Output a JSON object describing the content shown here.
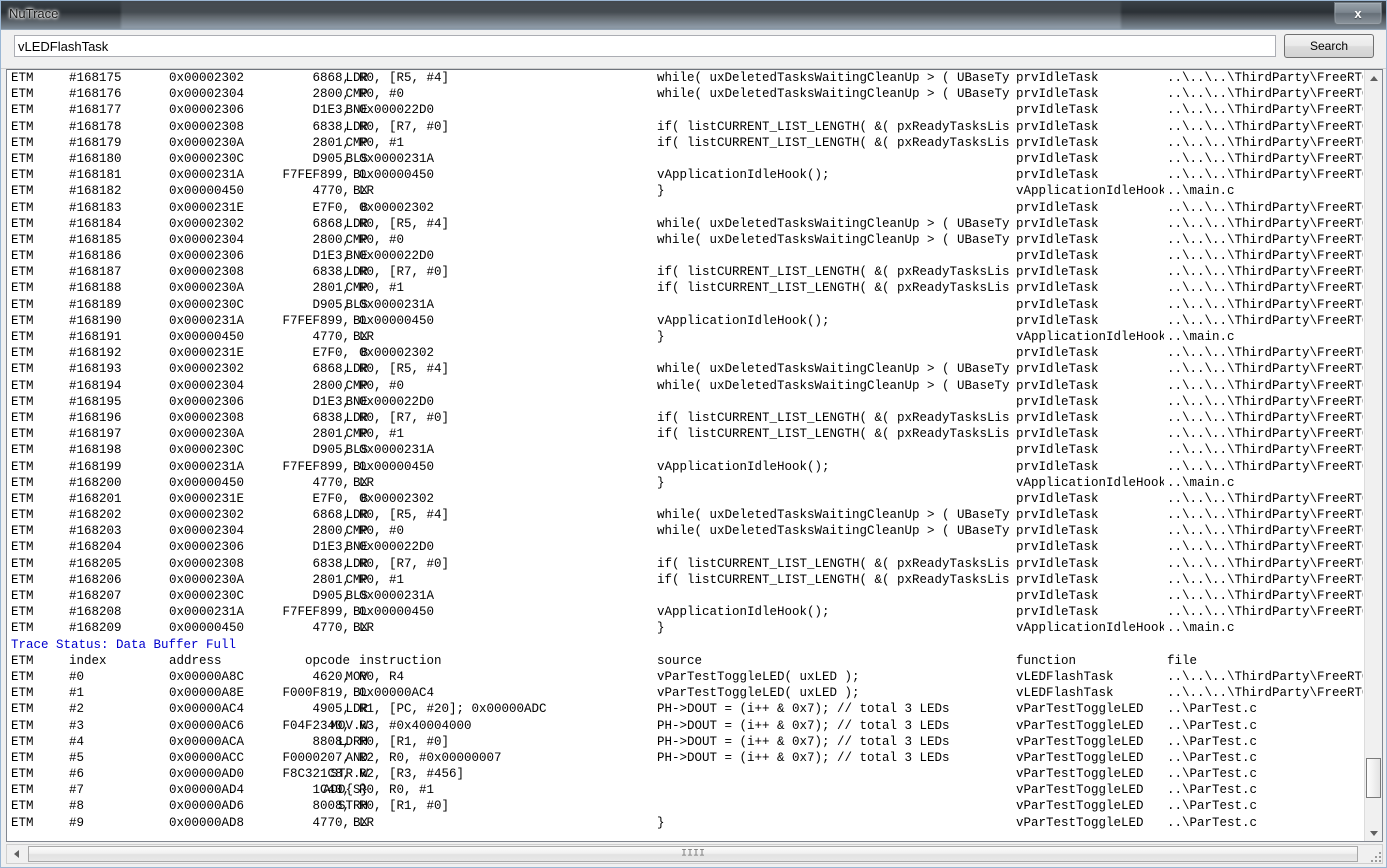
{
  "window": {
    "title": "NuTrace",
    "close_label": "x"
  },
  "search": {
    "value": "vLEDFlashTask",
    "placeholder": "",
    "button_label": "Search"
  },
  "columns": {
    "etm": "ETM",
    "index": "index",
    "address": "address",
    "opcode": "opcode",
    "instruction": "instruction",
    "source": "source",
    "function": "function",
    "file": "file"
  },
  "status": {
    "trace_status": "Trace Status: Data Buffer Full",
    "color": "#0000cc"
  },
  "scroll": {
    "h_grip": "IIII"
  },
  "strings": {
    "src_while": "while( uxDeletedTasksWaitingCleanUp > ( UBaseType_",
    "src_if": "if( listCURRENT_LIST_LENGTH( &( pxReadyTasksLists[",
    "src_hook": "vApplicationIdleHook();",
    "src_brace": "}",
    "src_toggle": "vParTestToggleLED( uxLED );",
    "src_dout": "PH->DOUT = (i++ & 0x7); // total 3 LEDs",
    "fn_idle": "prvIdleTask",
    "fn_hook": "vApplicationIdleHook",
    "fn_led": "vLEDFlashTask",
    "fn_partest": "vParTestToggleLED",
    "file_freertos": "..\\..\\..\\ThirdParty\\FreeRTOS\\",
    "file_main": "..\\main.c",
    "file_partest": "..\\ParTest.c"
  },
  "trace_rows": [
    {
      "etm": "ETM",
      "index": "#168175",
      "address": "0x00002302",
      "opcode": "6868,",
      "mnemonic": "LDR",
      "operands": "R0, [R5, #4]",
      "source": "while( uxDeletedTasksWaitingCleanUp > ( UBaseType_",
      "function": "prvIdleTask",
      "file": "..\\..\\..\\ThirdParty\\FreeRTOS\\"
    },
    {
      "etm": "ETM",
      "index": "#168176",
      "address": "0x00002304",
      "opcode": "2800,",
      "mnemonic": "CMP",
      "operands": "R0, #0",
      "source": "while( uxDeletedTasksWaitingCleanUp > ( UBaseType_",
      "function": "prvIdleTask",
      "file": "..\\..\\..\\ThirdParty\\FreeRTOS\\"
    },
    {
      "etm": "ETM",
      "index": "#168177",
      "address": "0x00002306",
      "opcode": "D1E3,",
      "mnemonic": "BNE",
      "operands": "0x000022D0",
      "source": "",
      "function": "prvIdleTask",
      "file": "..\\..\\..\\ThirdParty\\FreeRTOS\\"
    },
    {
      "etm": "ETM",
      "index": "#168178",
      "address": "0x00002308",
      "opcode": "6838,",
      "mnemonic": "LDR",
      "operands": "R0, [R7, #0]",
      "source": "if( listCURRENT_LIST_LENGTH( &( pxReadyTasksLists[",
      "function": "prvIdleTask",
      "file": "..\\..\\..\\ThirdParty\\FreeRTOS\\"
    },
    {
      "etm": "ETM",
      "index": "#168179",
      "address": "0x0000230A",
      "opcode": "2801,",
      "mnemonic": "CMP",
      "operands": "R0, #1",
      "source": "if( listCURRENT_LIST_LENGTH( &( pxReadyTasksLists[",
      "function": "prvIdleTask",
      "file": "..\\..\\..\\ThirdParty\\FreeRTOS\\"
    },
    {
      "etm": "ETM",
      "index": "#168180",
      "address": "0x0000230C",
      "opcode": "D905,",
      "mnemonic": "BLS",
      "operands": "0x0000231A",
      "source": "",
      "function": "prvIdleTask",
      "file": "..\\..\\..\\ThirdParty\\FreeRTOS\\"
    },
    {
      "etm": "ETM",
      "index": "#168181",
      "address": "0x0000231A",
      "opcode": "F7FEF899,",
      "mnemonic": "BL",
      "operands": "0x00000450",
      "source": "vApplicationIdleHook();",
      "function": "prvIdleTask",
      "file": "..\\..\\..\\ThirdParty\\FreeRTOS\\"
    },
    {
      "etm": "ETM",
      "index": "#168182",
      "address": "0x00000450",
      "opcode": "4770,",
      "mnemonic": "BX",
      "operands": "LR",
      "source": "}",
      "function": "vApplicationIdleHook",
      "file": "..\\main.c"
    },
    {
      "etm": "ETM",
      "index": "#168183",
      "address": "0x0000231E",
      "opcode": "E7F0,",
      "mnemonic": "B",
      "operands": "0x00002302",
      "source": "",
      "function": "prvIdleTask",
      "file": "..\\..\\..\\ThirdParty\\FreeRTOS\\"
    },
    {
      "etm": "ETM",
      "index": "#168184",
      "address": "0x00002302",
      "opcode": "6868,",
      "mnemonic": "LDR",
      "operands": "R0, [R5, #4]",
      "source": "while( uxDeletedTasksWaitingCleanUp > ( UBaseType_",
      "function": "prvIdleTask",
      "file": "..\\..\\..\\ThirdParty\\FreeRTOS\\"
    },
    {
      "etm": "ETM",
      "index": "#168185",
      "address": "0x00002304",
      "opcode": "2800,",
      "mnemonic": "CMP",
      "operands": "R0, #0",
      "source": "while( uxDeletedTasksWaitingCleanUp > ( UBaseType_",
      "function": "prvIdleTask",
      "file": "..\\..\\..\\ThirdParty\\FreeRTOS\\"
    },
    {
      "etm": "ETM",
      "index": "#168186",
      "address": "0x00002306",
      "opcode": "D1E3,",
      "mnemonic": "BNE",
      "operands": "0x000022D0",
      "source": "",
      "function": "prvIdleTask",
      "file": "..\\..\\..\\ThirdParty\\FreeRTOS\\"
    },
    {
      "etm": "ETM",
      "index": "#168187",
      "address": "0x00002308",
      "opcode": "6838,",
      "mnemonic": "LDR",
      "operands": "R0, [R7, #0]",
      "source": "if( listCURRENT_LIST_LENGTH( &( pxReadyTasksLists[",
      "function": "prvIdleTask",
      "file": "..\\..\\..\\ThirdParty\\FreeRTOS\\"
    },
    {
      "etm": "ETM",
      "index": "#168188",
      "address": "0x0000230A",
      "opcode": "2801,",
      "mnemonic": "CMP",
      "operands": "R0, #1",
      "source": "if( listCURRENT_LIST_LENGTH( &( pxReadyTasksLists[",
      "function": "prvIdleTask",
      "file": "..\\..\\..\\ThirdParty\\FreeRTOS\\"
    },
    {
      "etm": "ETM",
      "index": "#168189",
      "address": "0x0000230C",
      "opcode": "D905,",
      "mnemonic": "BLS",
      "operands": "0x0000231A",
      "source": "",
      "function": "prvIdleTask",
      "file": "..\\..\\..\\ThirdParty\\FreeRTOS\\"
    },
    {
      "etm": "ETM",
      "index": "#168190",
      "address": "0x0000231A",
      "opcode": "F7FEF899,",
      "mnemonic": "BL",
      "operands": "0x00000450",
      "source": "vApplicationIdleHook();",
      "function": "prvIdleTask",
      "file": "..\\..\\..\\ThirdParty\\FreeRTOS\\"
    },
    {
      "etm": "ETM",
      "index": "#168191",
      "address": "0x00000450",
      "opcode": "4770,",
      "mnemonic": "BX",
      "operands": "LR",
      "source": "}",
      "function": "vApplicationIdleHook",
      "file": "..\\main.c"
    },
    {
      "etm": "ETM",
      "index": "#168192",
      "address": "0x0000231E",
      "opcode": "E7F0,",
      "mnemonic": "B",
      "operands": "0x00002302",
      "source": "",
      "function": "prvIdleTask",
      "file": "..\\..\\..\\ThirdParty\\FreeRTOS\\"
    },
    {
      "etm": "ETM",
      "index": "#168193",
      "address": "0x00002302",
      "opcode": "6868,",
      "mnemonic": "LDR",
      "operands": "R0, [R5, #4]",
      "source": "while( uxDeletedTasksWaitingCleanUp > ( UBaseType_",
      "function": "prvIdleTask",
      "file": "..\\..\\..\\ThirdParty\\FreeRTOS\\"
    },
    {
      "etm": "ETM",
      "index": "#168194",
      "address": "0x00002304",
      "opcode": "2800,",
      "mnemonic": "CMP",
      "operands": "R0, #0",
      "source": "while( uxDeletedTasksWaitingCleanUp > ( UBaseType_",
      "function": "prvIdleTask",
      "file": "..\\..\\..\\ThirdParty\\FreeRTOS\\"
    },
    {
      "etm": "ETM",
      "index": "#168195",
      "address": "0x00002306",
      "opcode": "D1E3,",
      "mnemonic": "BNE",
      "operands": "0x000022D0",
      "source": "",
      "function": "prvIdleTask",
      "file": "..\\..\\..\\ThirdParty\\FreeRTOS\\"
    },
    {
      "etm": "ETM",
      "index": "#168196",
      "address": "0x00002308",
      "opcode": "6838,",
      "mnemonic": "LDR",
      "operands": "R0, [R7, #0]",
      "source": "if( listCURRENT_LIST_LENGTH( &( pxReadyTasksLists[",
      "function": "prvIdleTask",
      "file": "..\\..\\..\\ThirdParty\\FreeRTOS\\"
    },
    {
      "etm": "ETM",
      "index": "#168197",
      "address": "0x0000230A",
      "opcode": "2801,",
      "mnemonic": "CMP",
      "operands": "R0, #1",
      "source": "if( listCURRENT_LIST_LENGTH( &( pxReadyTasksLists[",
      "function": "prvIdleTask",
      "file": "..\\..\\..\\ThirdParty\\FreeRTOS\\"
    },
    {
      "etm": "ETM",
      "index": "#168198",
      "address": "0x0000230C",
      "opcode": "D905,",
      "mnemonic": "BLS",
      "operands": "0x0000231A",
      "source": "",
      "function": "prvIdleTask",
      "file": "..\\..\\..\\ThirdParty\\FreeRTOS\\"
    },
    {
      "etm": "ETM",
      "index": "#168199",
      "address": "0x0000231A",
      "opcode": "F7FEF899,",
      "mnemonic": "BL",
      "operands": "0x00000450",
      "source": "vApplicationIdleHook();",
      "function": "prvIdleTask",
      "file": "..\\..\\..\\ThirdParty\\FreeRTOS\\"
    },
    {
      "etm": "ETM",
      "index": "#168200",
      "address": "0x00000450",
      "opcode": "4770,",
      "mnemonic": "BX",
      "operands": "LR",
      "source": "}",
      "function": "vApplicationIdleHook",
      "file": "..\\main.c"
    },
    {
      "etm": "ETM",
      "index": "#168201",
      "address": "0x0000231E",
      "opcode": "E7F0,",
      "mnemonic": "B",
      "operands": "0x00002302",
      "source": "",
      "function": "prvIdleTask",
      "file": "..\\..\\..\\ThirdParty\\FreeRTOS\\"
    },
    {
      "etm": "ETM",
      "index": "#168202",
      "address": "0x00002302",
      "opcode": "6868,",
      "mnemonic": "LDR",
      "operands": "R0, [R5, #4]",
      "source": "while( uxDeletedTasksWaitingCleanUp > ( UBaseType_",
      "function": "prvIdleTask",
      "file": "..\\..\\..\\ThirdParty\\FreeRTOS\\"
    },
    {
      "etm": "ETM",
      "index": "#168203",
      "address": "0x00002304",
      "opcode": "2800,",
      "mnemonic": "CMP",
      "operands": "R0, #0",
      "source": "while( uxDeletedTasksWaitingCleanUp > ( UBaseType_",
      "function": "prvIdleTask",
      "file": "..\\..\\..\\ThirdParty\\FreeRTOS\\"
    },
    {
      "etm": "ETM",
      "index": "#168204",
      "address": "0x00002306",
      "opcode": "D1E3,",
      "mnemonic": "BNE",
      "operands": "0x000022D0",
      "source": "",
      "function": "prvIdleTask",
      "file": "..\\..\\..\\ThirdParty\\FreeRTOS\\"
    },
    {
      "etm": "ETM",
      "index": "#168205",
      "address": "0x00002308",
      "opcode": "6838,",
      "mnemonic": "LDR",
      "operands": "R0, [R7, #0]",
      "source": "if( listCURRENT_LIST_LENGTH( &( pxReadyTasksLists[",
      "function": "prvIdleTask",
      "file": "..\\..\\..\\ThirdParty\\FreeRTOS\\"
    },
    {
      "etm": "ETM",
      "index": "#168206",
      "address": "0x0000230A",
      "opcode": "2801,",
      "mnemonic": "CMP",
      "operands": "R0, #1",
      "source": "if( listCURRENT_LIST_LENGTH( &( pxReadyTasksLists[",
      "function": "prvIdleTask",
      "file": "..\\..\\..\\ThirdParty\\FreeRTOS\\"
    },
    {
      "etm": "ETM",
      "index": "#168207",
      "address": "0x0000230C",
      "opcode": "D905,",
      "mnemonic": "BLS",
      "operands": "0x0000231A",
      "source": "",
      "function": "prvIdleTask",
      "file": "..\\..\\..\\ThirdParty\\FreeRTOS\\"
    },
    {
      "etm": "ETM",
      "index": "#168208",
      "address": "0x0000231A",
      "opcode": "F7FEF899,",
      "mnemonic": "BL",
      "operands": "0x00000450",
      "source": "vApplicationIdleHook();",
      "function": "prvIdleTask",
      "file": "..\\..\\..\\ThirdParty\\FreeRTOS\\"
    },
    {
      "etm": "ETM",
      "index": "#168209",
      "address": "0x00000450",
      "opcode": "4770,",
      "mnemonic": "BX",
      "operands": "LR",
      "source": "}",
      "function": "vApplicationIdleHook",
      "file": "..\\main.c"
    }
  ],
  "trace_rows2": [
    {
      "etm": "ETM",
      "index": "index",
      "address": "address",
      "opcode": "opcode",
      "mnemonic": "",
      "operands": "instruction",
      "source": "source",
      "function": "function",
      "file": "file",
      "header": true
    },
    {
      "etm": "ETM",
      "index": "#0",
      "address": "0x00000A8C",
      "opcode": "4620,",
      "mnemonic": "MOV",
      "operands": "R0, R4",
      "source": "vParTestToggleLED( uxLED );",
      "function": "vLEDFlashTask",
      "file": "..\\..\\..\\ThirdParty\\FreeRTOS\\"
    },
    {
      "etm": "ETM",
      "index": "#1",
      "address": "0x00000A8E",
      "opcode": "F000F819,",
      "mnemonic": "BL",
      "operands": "0x00000AC4",
      "source": "vParTestToggleLED( uxLED );",
      "function": "vLEDFlashTask",
      "file": "..\\..\\..\\ThirdParty\\FreeRTOS\\"
    },
    {
      "etm": "ETM",
      "index": "#2",
      "address": "0x00000AC4",
      "opcode": "4905,",
      "mnemonic": "LDR",
      "operands": "R1, [PC, #20]; 0x00000ADC",
      "source": "PH->DOUT = (i++ & 0x7); // total 3 LEDs",
      "function": "vParTestToggleLED",
      "file": "..\\ParTest.c"
    },
    {
      "etm": "ETM",
      "index": "#3",
      "address": "0x00000AC6",
      "opcode": "F04F2340,",
      "mnemonic": "MOV.W",
      "operands": "R3, #0x40004000",
      "source": "PH->DOUT = (i++ & 0x7); // total 3 LEDs",
      "function": "vParTestToggleLED",
      "file": "..\\ParTest.c"
    },
    {
      "etm": "ETM",
      "index": "#4",
      "address": "0x00000ACA",
      "opcode": "8808,",
      "mnemonic": "LDRH",
      "operands": "R0, [R1, #0]",
      "source": "PH->DOUT = (i++ & 0x7); // total 3 LEDs",
      "function": "vParTestToggleLED",
      "file": "..\\ParTest.c"
    },
    {
      "etm": "ETM",
      "index": "#5",
      "address": "0x00000ACC",
      "opcode": "F0000207,",
      "mnemonic": "AND",
      "operands": "R2, R0, #0x00000007",
      "source": "PH->DOUT = (i++ & 0x7); // total 3 LEDs",
      "function": "vParTestToggleLED",
      "file": "..\\ParTest.c"
    },
    {
      "etm": "ETM",
      "index": "#6",
      "address": "0x00000AD0",
      "opcode": "F8C321C8,",
      "mnemonic": "STR.W",
      "operands": "R2, [R3, #456]",
      "source": "",
      "function": "vParTestToggleLED",
      "file": "..\\ParTest.c"
    },
    {
      "etm": "ETM",
      "index": "#7",
      "address": "0x00000AD4",
      "opcode": "1C40,",
      "mnemonic": "ADD{S}",
      "operands": "R0, R0, #1",
      "source": "",
      "function": "vParTestToggleLED",
      "file": "..\\ParTest.c"
    },
    {
      "etm": "ETM",
      "index": "#8",
      "address": "0x00000AD6",
      "opcode": "8008,",
      "mnemonic": "STRH",
      "operands": "R0, [R1, #0]",
      "source": "",
      "function": "vParTestToggleLED",
      "file": "..\\ParTest.c"
    },
    {
      "etm": "ETM",
      "index": "#9",
      "address": "0x00000AD8",
      "opcode": "4770,",
      "mnemonic": "BX",
      "operands": "LR",
      "source": "}",
      "function": "vParTestToggleLED",
      "file": "..\\ParTest.c"
    }
  ]
}
